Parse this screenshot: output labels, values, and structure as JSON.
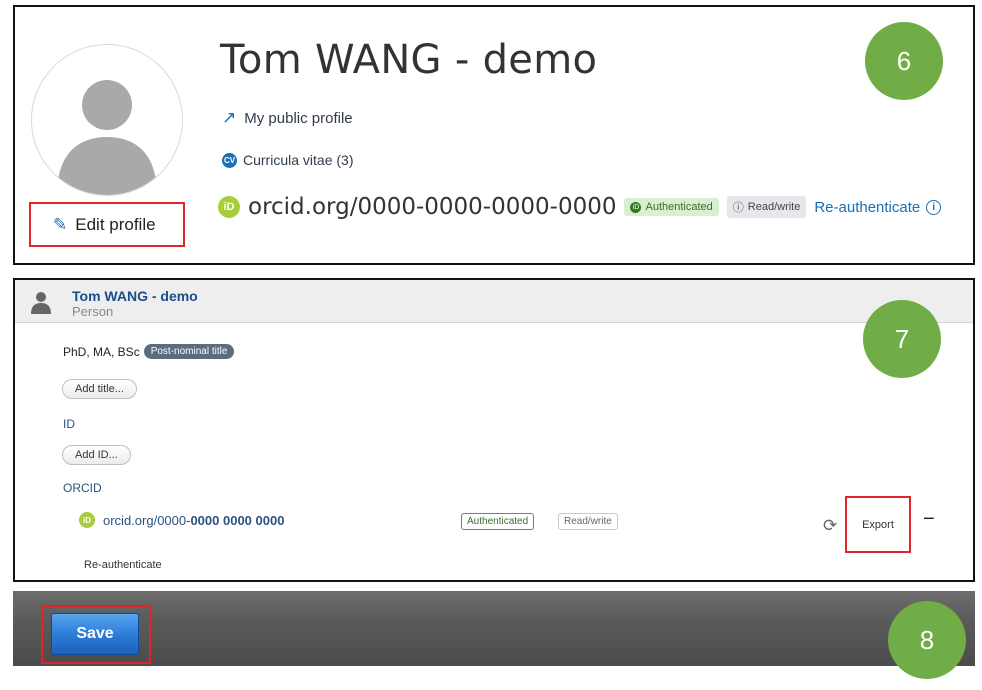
{
  "header": {
    "name": "Tom WANG - demo",
    "public_profile": "My public profile",
    "curricula_vitae": "Curricula vitae (3)",
    "cv_icon": "CV",
    "orcid_logo": "iD",
    "orcid": "orcid.org/0000-0000-0000-0000",
    "authenticated": "Authenticated",
    "read_write": "Read/write",
    "reauthenticate": "Re-authenticate",
    "edit_profile": "Edit profile"
  },
  "editor": {
    "name": "Tom WANG - demo",
    "type": "Person",
    "post_nominal": "PhD, MA, BSc",
    "post_nominal_tag": "Post-nominal title",
    "add_title": "Add title...",
    "id_label": "ID",
    "add_id": "Add ID...",
    "orcid_label": "ORCID",
    "orcid_logo": "iD",
    "orcid_prefix": "orcid.org/0000-",
    "orcid_rest": "0000 0000 0000",
    "authenticated": "Authenticated",
    "read_write": "Read/write",
    "export": "Export",
    "reauthenticate": "Re-authenticate"
  },
  "footer": {
    "save": "Save"
  },
  "callouts": {
    "c6": "6",
    "c7": "7",
    "c8": "8"
  },
  "colors": {
    "callout_green": "#70ad47",
    "highlight_red": "#e0242a",
    "link_blue": "#1b6fb5",
    "orcid_green": "#a6ce39"
  }
}
